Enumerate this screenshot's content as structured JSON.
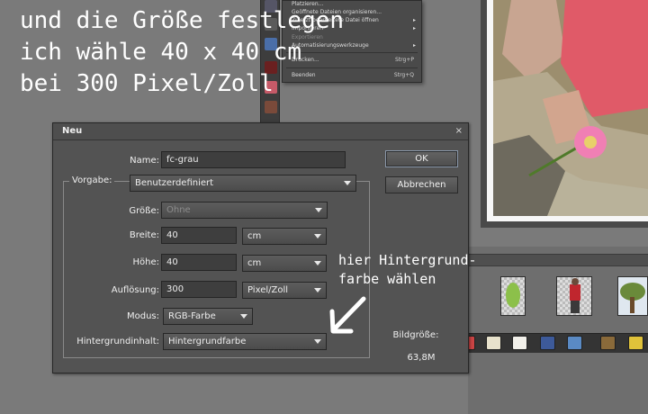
{
  "caption": {
    "line1": "und die Größe festlegen",
    "line2": "ich wähle 40 x 40 cm",
    "line3": "bei 300 Pixel/Zoll"
  },
  "side_note": {
    "line1": "hier Hintergrund-",
    "line2": "farbe wählen"
  },
  "file_menu": {
    "item1": "Platzieren...",
    "item2": "Geöffnete Dateien organisieren...",
    "item3": "Zuletzt bearbeitete Datei öffnen",
    "item4": "Importieren",
    "item5": "Exportieren",
    "item6": "Automatisierungswerkzeuge",
    "item7": "Drucken...",
    "item7_shortcut": "Strg+P",
    "item8": "Beenden",
    "item8_shortcut": "Strg+Q"
  },
  "dialog": {
    "title": "Neu",
    "close": "×",
    "name_label": "Name:",
    "name_value": "fc-grau",
    "preset_label": "Vorgabe:",
    "preset_value": "Benutzerdefiniert",
    "size_label": "Größe:",
    "size_value": "Ohne",
    "width_label": "Breite:",
    "width_value": "40",
    "width_unit": "cm",
    "height_label": "Höhe:",
    "height_value": "40",
    "height_unit": "cm",
    "resolution_label": "Auflösung:",
    "resolution_value": "300",
    "resolution_unit": "Pixel/Zoll",
    "mode_label": "Modus:",
    "mode_value": "RGB-Farbe",
    "background_label": "Hintergrundinhalt:",
    "background_value": "Hintergrundfarbe",
    "ok_label": "OK",
    "cancel_label": "Abbrechen",
    "image_size_label": "Bildgröße:",
    "image_size_value": "63,8M"
  },
  "icons": {
    "tools": [
      "zoom-icon",
      "hand-icon",
      "eyedropper-icon",
      "red-eye-icon",
      "eraser-icon",
      "brush-icon"
    ],
    "taskbar": [
      "calendar-icon",
      "document-icon",
      "web-gallery-icon",
      "photo-icon",
      "tile-icon",
      "cd-icon"
    ]
  },
  "colors": {
    "background": "#7a7a7a",
    "dialog": "#535353",
    "field": "#3e3e3e",
    "text": "#f0f0f0"
  }
}
